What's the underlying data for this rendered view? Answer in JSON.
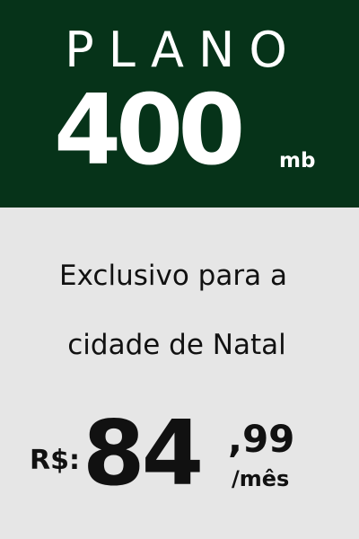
{
  "header": {
    "title": "PLANO",
    "speed": "400",
    "unit": "mb"
  },
  "description": {
    "line1": "Exclusivo para a",
    "line2": "cidade de Natal"
  },
  "price": {
    "currency": "R$:",
    "integer": "84",
    "decimal": ",99",
    "period": "/mês"
  },
  "colors": {
    "header_background": "#063319",
    "body_background": "#e6e6e6",
    "header_text": "#ffffff",
    "body_text": "#111111"
  }
}
